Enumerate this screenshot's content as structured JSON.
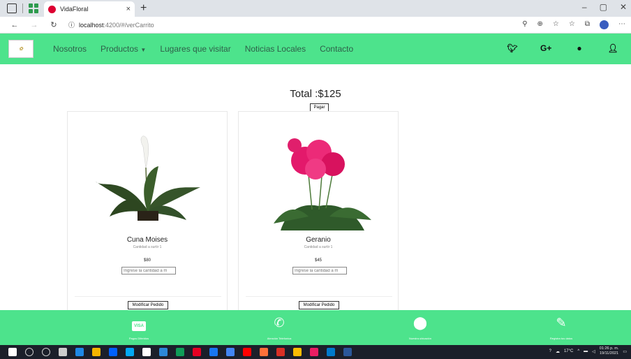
{
  "browser": {
    "tab_title": "VidaFloral",
    "tab_close": "×",
    "new_tab": "+",
    "url_info": "ⓘ",
    "url_host": "localhost",
    "url_path": ":4200/#/verCarrito"
  },
  "navbar": {
    "logo_text": "Vida Floral",
    "links": [
      "Nosotros",
      "Productos",
      "Lugares que visitar",
      "Noticias Locales",
      "Contacto"
    ],
    "social": [
      "twitter-icon",
      "google-plus-icon",
      "github-icon",
      "user-icon"
    ],
    "google_label": "G+"
  },
  "cart": {
    "total_label": "Total :$125",
    "pay_button": "Pagar",
    "items": [
      {
        "name": "Cuna Moises",
        "quantity_label": "Cantidad a surtir 1",
        "price": "$80",
        "qty_placeholder": "Ingrese la cantidad a m",
        "modify_button": "Modificar Pedido"
      },
      {
        "name": "Geranio",
        "quantity_label": "Cantidad a surtir 1",
        "price": "$45",
        "qty_placeholder": "Ingrese la cantidad a m",
        "modify_button": "Modificar Pedido"
      }
    ]
  },
  "footer": {
    "items": [
      {
        "icon": "visa-card-icon",
        "label": "Pagos Diferidos",
        "glyph": "VISA"
      },
      {
        "icon": "phone-icon",
        "label": "Atención Telefonica",
        "glyph": "✆"
      },
      {
        "icon": "map-pin-icon",
        "label": "Nuestra ubicación",
        "glyph": "⬤"
      },
      {
        "icon": "edit-icon",
        "label": "Registra tus datos",
        "glyph": "✎"
      }
    ]
  },
  "taskbar": {
    "weather": "17°C",
    "time": "01:26 p. m.",
    "date": "19/11/2021"
  },
  "colors": {
    "brand_green": "#4de38c",
    "nav_text": "#2f5f49"
  }
}
